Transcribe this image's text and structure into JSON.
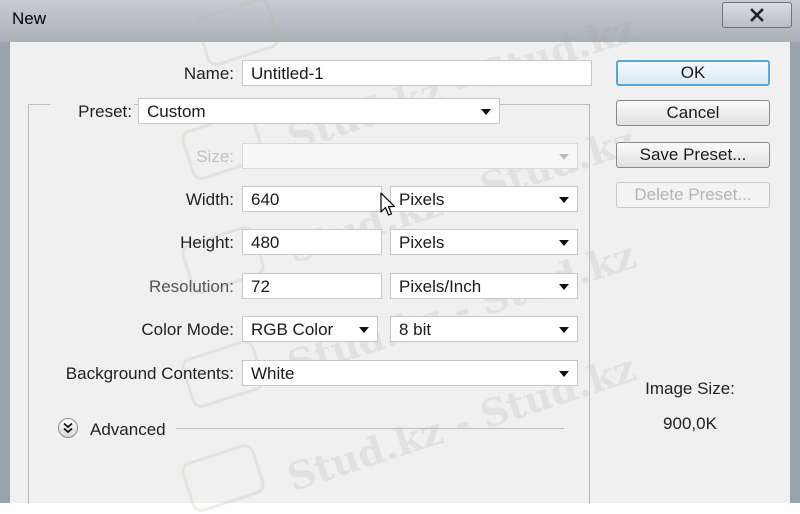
{
  "window": {
    "title": "New"
  },
  "form": {
    "name_label": "Name:",
    "name_value": "Untitled-1",
    "preset_label": "Preset:",
    "preset_value": "Custom",
    "size_label": "Size:",
    "size_value": "",
    "width_label": "Width:",
    "width_value": "640",
    "width_unit": "Pixels",
    "height_label": "Height:",
    "height_value": "480",
    "height_unit": "Pixels",
    "resolution_label": "Resolution:",
    "resolution_value": "72",
    "resolution_unit": "Pixels/Inch",
    "color_mode_label": "Color Mode:",
    "color_mode_value": "RGB Color",
    "bit_depth_value": "8 bit",
    "background_label": "Background Contents:",
    "background_value": "White",
    "advanced_label": "Advanced"
  },
  "buttons": {
    "ok": "OK",
    "cancel": "Cancel",
    "save_preset": "Save Preset...",
    "delete_preset": "Delete Preset..."
  },
  "info": {
    "image_size_label": "Image Size:",
    "image_size_value": "900,0K"
  },
  "watermark": {
    "text_1": "Stud.kz - Stud.kz",
    "text_2": "Stud.kz - Stud.kz",
    "text_3": "Stud.kz - Stud.kz",
    "text_4": "Stud.kz - Stud.kz",
    "text_5": "Stud.kz - Stud.kz"
  }
}
